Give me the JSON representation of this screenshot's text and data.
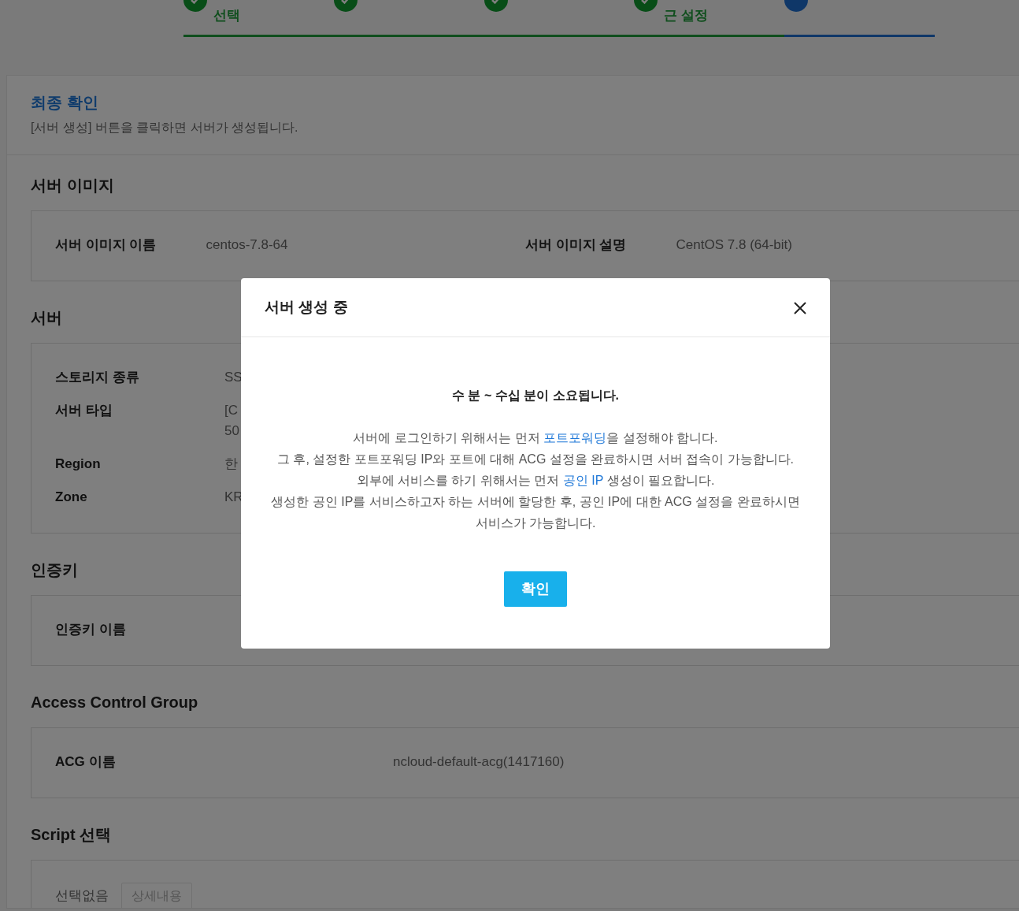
{
  "steps": [
    {
      "label_visible": "선택",
      "done": true
    },
    {
      "done": true
    },
    {
      "done": true
    },
    {
      "label_visible": "근 설정",
      "done": true
    },
    {
      "done": false
    }
  ],
  "card": {
    "title": "최종 확인",
    "subtitle": "[서버 생성] 버튼을 클릭하면 서버가 생성됩니다."
  },
  "sections": [
    {
      "title": "서버 이미지",
      "kind": "grid2",
      "rows": [
        {
          "label": "서버 이미지 이름",
          "value": "centos-7.8-64"
        },
        {
          "label": "서버 이미지 설명",
          "value": "CentOS 7.8 (64-bit)"
        }
      ]
    },
    {
      "title": "서버",
      "kind": "list",
      "rows": [
        {
          "label": "스토리지 종류",
          "value": "SS"
        },
        {
          "label": "서버 타입",
          "value": "[C\n50"
        },
        {
          "label": "Region",
          "value": "한"
        },
        {
          "label": "Zone",
          "value": "KR"
        }
      ]
    },
    {
      "title": "인증키",
      "kind": "list",
      "rows": [
        {
          "label": "인증키 이름"
        }
      ]
    },
    {
      "title": "Access Control Group",
      "kind": "wide",
      "rows": [
        {
          "label": "ACG 이름",
          "value": "ncloud-default-acg(1417160)"
        }
      ]
    },
    {
      "title": "Script 선택",
      "kind": "script",
      "rows": [
        {
          "label": "선택없음",
          "value": "상세내용"
        }
      ]
    }
  ],
  "modal": {
    "title": "서버 생성 중",
    "headline": "수 분 ~ 수십 분이 소요됩니다.",
    "lines": [
      [
        {
          "text": "서버에 로그인하기 위해서는 먼저 ",
          "kind": "text"
        },
        {
          "text": "포트포워딩",
          "kind": "link"
        },
        {
          "text": "을 설정해야 합니다.",
          "kind": "text"
        }
      ],
      [
        {
          "text": "그 후, 설정한 포트포워딩 IP와 포트에 대해 ACG 설정을 완료하시면 서버 접속이 가능합니다.",
          "kind": "text"
        }
      ],
      [
        {
          "text": "외부에 서비스를 하기 위해서는 먼저 ",
          "kind": "text"
        },
        {
          "text": "공인 IP",
          "kind": "link"
        },
        {
          "text": " 생성이 필요합니다.",
          "kind": "text"
        }
      ],
      [
        {
          "text": "생성한 공인 IP를 서비스하고자 하는 서버에 할당한 후, 공인 IP에 대한 ACG 설정을 완료하시면 서비스가 가능합니다.",
          "kind": "text"
        }
      ]
    ],
    "button": "확인"
  }
}
